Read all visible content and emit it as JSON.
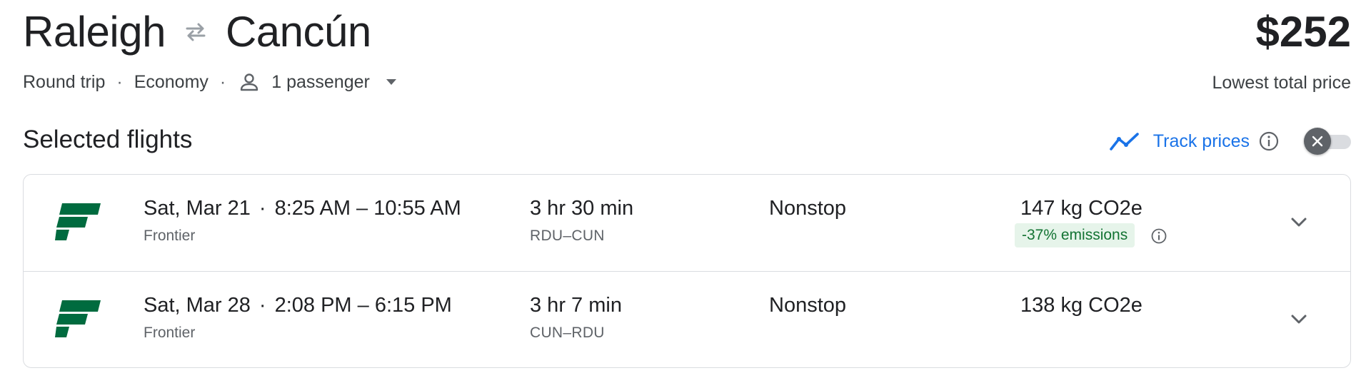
{
  "header": {
    "origin": "Raleigh",
    "destination": "Cancún",
    "price": "$252",
    "price_label": "Lowest total price"
  },
  "options": {
    "trip_type": "Round trip",
    "separator": "·",
    "cabin": "Economy",
    "passengers": "1 passenger"
  },
  "section": {
    "title": "Selected flights"
  },
  "track": {
    "label": "Track prices",
    "enabled": false
  },
  "flights": [
    {
      "date": "Sat, Mar 21",
      "sep": "·",
      "time_range": "8:25 AM – 10:55 AM",
      "airline": "Frontier",
      "duration": "3 hr 30 min",
      "route": "RDU–CUN",
      "stops": "Nonstop",
      "co2": "147 kg CO2e",
      "emissions": "-37% emissions"
    },
    {
      "date": "Sat, Mar 28",
      "sep": "·",
      "time_range": "2:08 PM – 6:15 PM",
      "airline": "Frontier",
      "duration": "3 hr 7 min",
      "route": "CUN–RDU",
      "stops": "Nonstop",
      "co2": "138 kg CO2e",
      "emissions": ""
    }
  ],
  "colors": {
    "accent": "#1a73e8",
    "frontier_green": "#006b3f",
    "emissions_bg": "#e6f4ea",
    "emissions_text": "#137333"
  },
  "icons": {
    "swap": "swap-arrows-icon",
    "person": "person-icon",
    "dropdown": "caret-down-icon",
    "trend": "trend-line-icon",
    "info": "info-icon",
    "close": "close-icon",
    "chevron": "chevron-down-icon",
    "airline_logo": "frontier-logo"
  }
}
